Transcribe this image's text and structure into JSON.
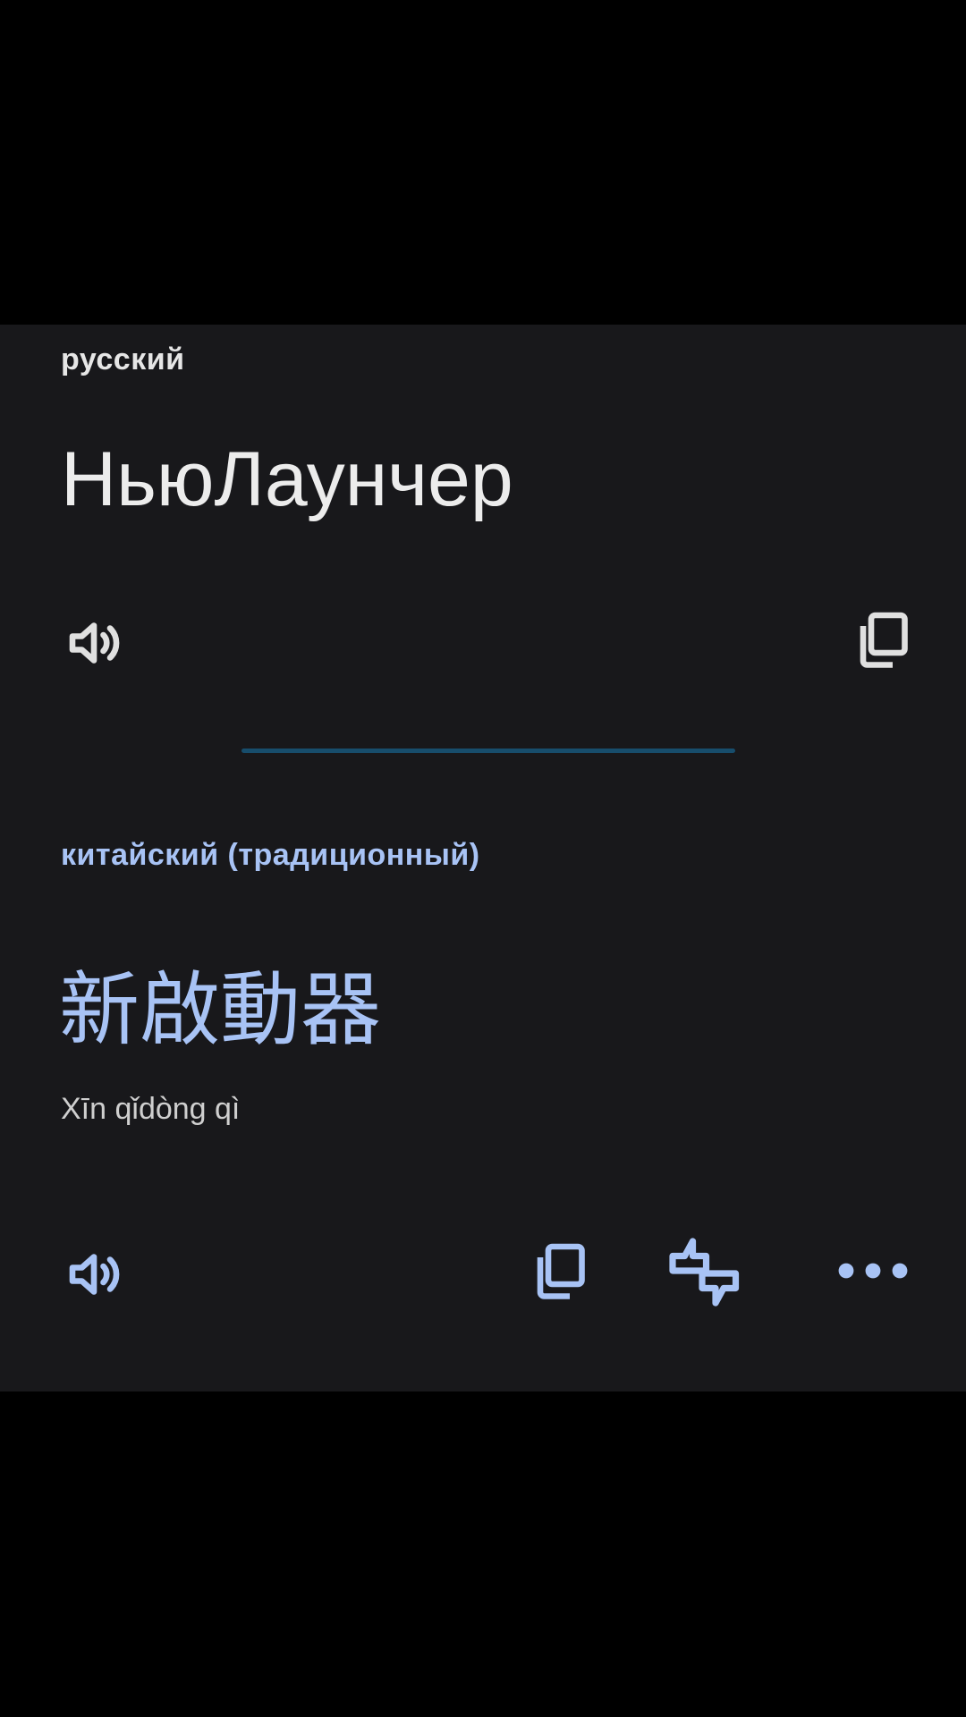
{
  "source": {
    "language": "русский",
    "text": "НьюЛаунчер",
    "icons": {
      "speak": "volume-icon",
      "copy": "copy-icon"
    }
  },
  "target": {
    "language": "китайский (традиционный)",
    "text": "新啟動器",
    "transliteration": "Xīn qǐdòng qì",
    "icons": {
      "speak": "volume-icon",
      "copy": "copy-icon",
      "feedback": "rate-translation-icon",
      "more": "more-horizontal-icon"
    }
  },
  "colors": {
    "background": "#000000",
    "card": "#18181b",
    "source_icon": "#e0e0e0",
    "accent": "#a8c3f5",
    "divider": "#174d6c"
  }
}
